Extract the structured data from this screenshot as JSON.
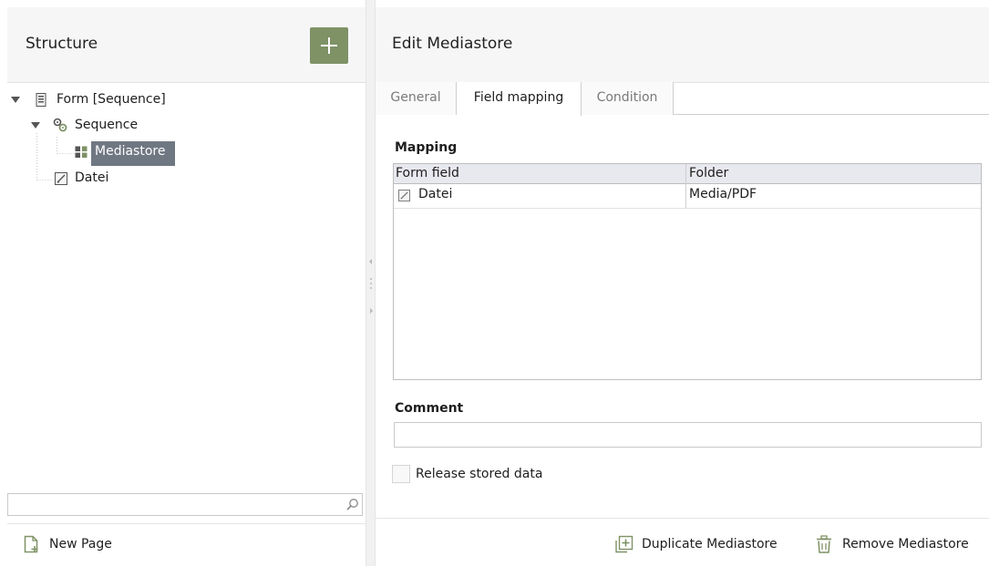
{
  "structure": {
    "title": "Structure",
    "add_icon": "plus-icon",
    "tree": {
      "root": {
        "label": "Form [Sequence]",
        "icon": "form-icon"
      },
      "sequence": {
        "label": "Sequence",
        "icon": "sequence-gears-icon"
      },
      "mediastore": {
        "label": "Mediastore",
        "icon": "mediastore-icon"
      },
      "datei": {
        "label": "Datei",
        "icon": "file-field-icon"
      }
    },
    "search": {
      "placeholder": "",
      "icon": "search-icon"
    },
    "new_page_label": "New Page"
  },
  "editor": {
    "title": "Edit Mediastore",
    "tabs": [
      {
        "label": "General",
        "active": false
      },
      {
        "label": "Field mapping",
        "active": true
      },
      {
        "label": "Condition",
        "active": false
      }
    ],
    "mapping": {
      "label": "Mapping",
      "columns": [
        "Form field",
        "Folder"
      ],
      "rows": [
        {
          "form_field": "Datei",
          "folder": "Media/PDF"
        }
      ]
    },
    "comment": {
      "label": "Comment",
      "value": ""
    },
    "release": {
      "label": "Release stored data",
      "checked": false
    },
    "duplicate_label": "Duplicate Mediastore",
    "remove_label": "Remove Mediastore"
  },
  "colors": {
    "accent_green": "#7e9266",
    "selection": "#6f7782",
    "header_bg": "#f6f6f7"
  }
}
